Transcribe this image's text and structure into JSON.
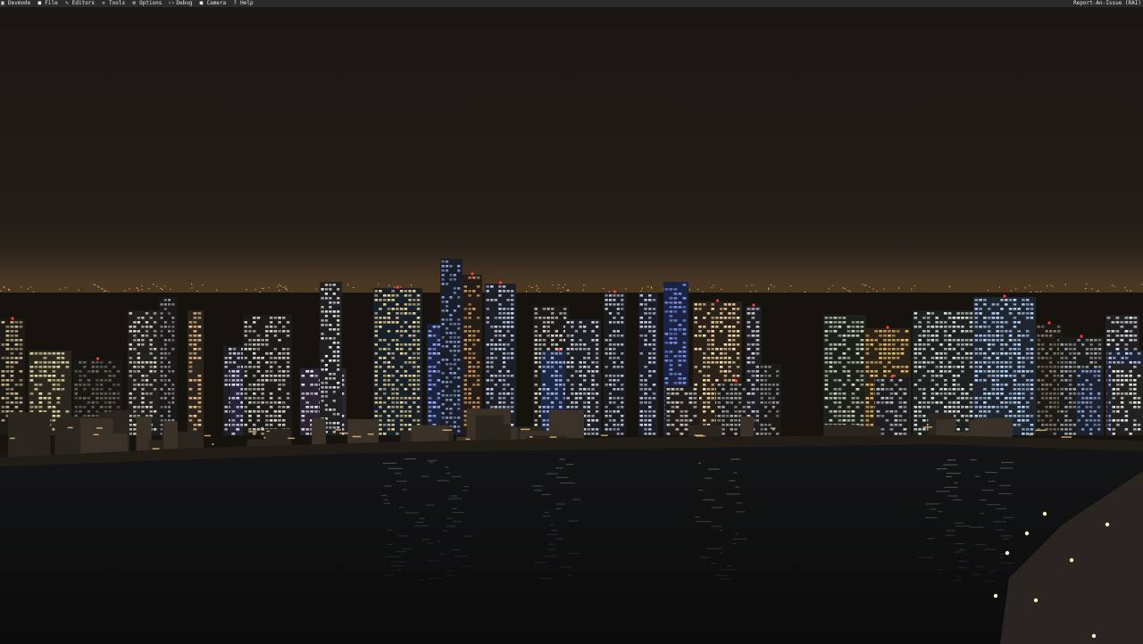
{
  "menubar": {
    "items": [
      {
        "label": "Devmode",
        "icon": "devmode-icon"
      },
      {
        "label": "File",
        "icon": "file-icon"
      },
      {
        "label": "Editors",
        "icon": "pencil-icon"
      },
      {
        "label": "Tools",
        "icon": "tools-icon"
      },
      {
        "label": "Options",
        "icon": "gear-icon"
      },
      {
        "label": "Debug",
        "icon": "code-icon"
      },
      {
        "label": "Camera",
        "icon": "camera-icon"
      },
      {
        "label": "Help",
        "icon": "help-icon"
      }
    ],
    "report_label": "Report-An-Issue (RAI)"
  },
  "colors": {
    "menubar_bg": "#2b2b2b",
    "sky_top": "#1c1813",
    "sky_horizon": "#3a2e22",
    "water": "#0f0f10"
  }
}
